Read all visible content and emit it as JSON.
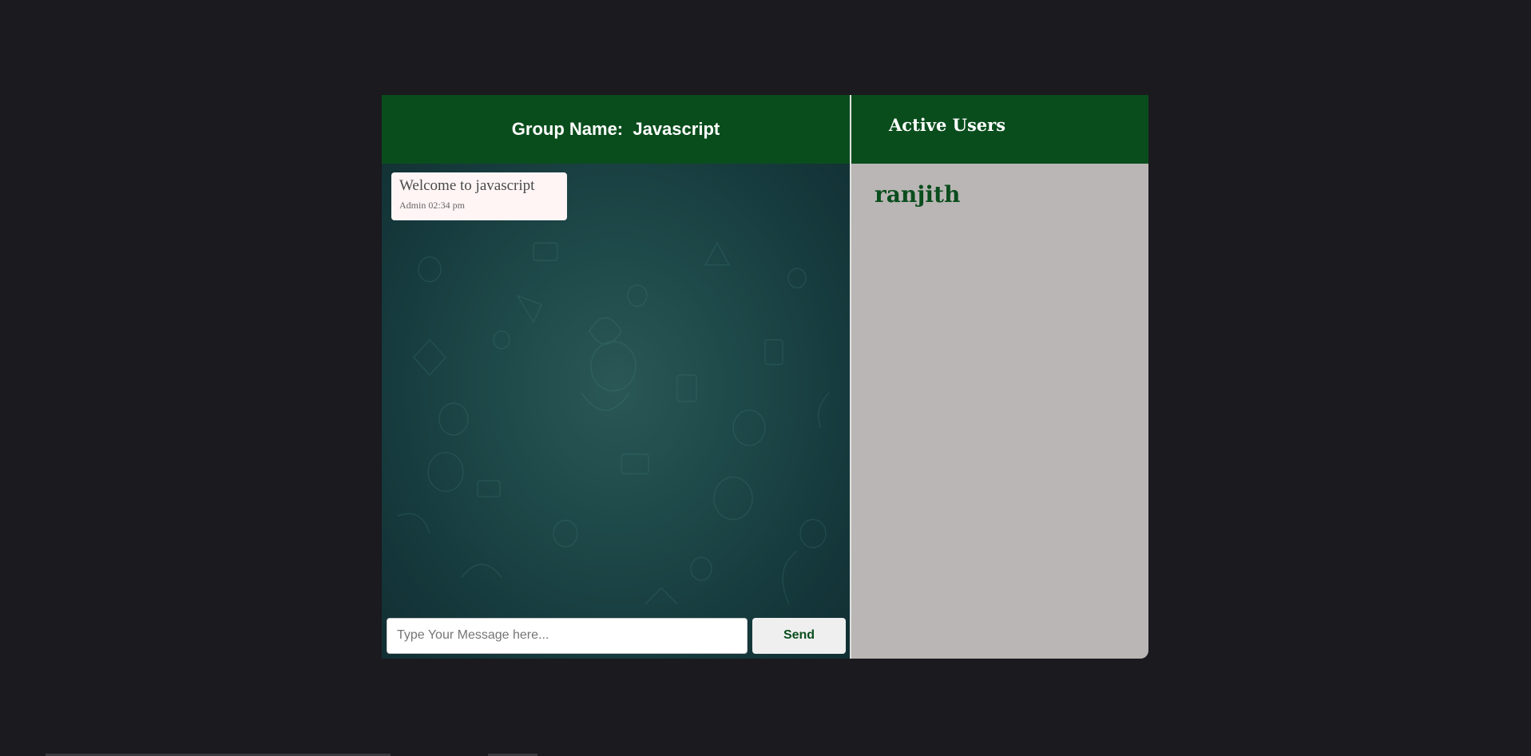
{
  "chat": {
    "header_title": "Group Name:  Javascript",
    "messages": [
      {
        "text": "Welcome to javascript",
        "sender": "Admin",
        "time": "02:34 pm",
        "meta": "Admin 02:34 pm"
      }
    ],
    "input_placeholder": "Type Your Message here...",
    "input_value": "",
    "send_label": "Send"
  },
  "users": {
    "header_title": "Active Users",
    "items": [
      "ranjith"
    ]
  },
  "colors": {
    "background": "#1b1a1f",
    "header_green": "#0a4d1d",
    "users_panel": "#bab6b5",
    "chat_bg": "#1f4a4a",
    "message_bubble": "#fff5f5"
  }
}
